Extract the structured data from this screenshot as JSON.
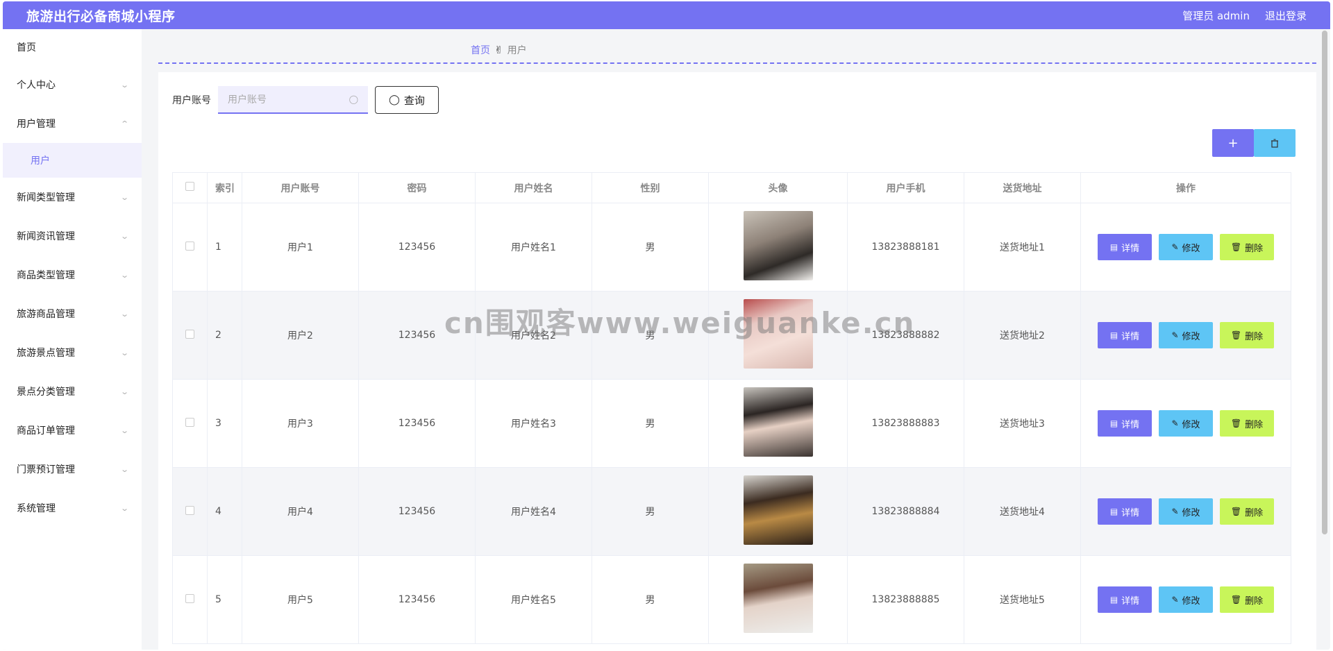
{
  "header": {
    "title": "旅游出行必备商城小程序",
    "user": "管理员 admin",
    "logout": "退出登录"
  },
  "sidebar": {
    "items": [
      {
        "label": "首页",
        "has_children": false
      },
      {
        "label": "个人中心",
        "has_children": true
      },
      {
        "label": "用户管理",
        "has_children": true,
        "expanded": true,
        "children": [
          "用户"
        ]
      },
      {
        "label": "新闻类型管理",
        "has_children": true
      },
      {
        "label": "新闻资讯管理",
        "has_children": true
      },
      {
        "label": "商品类型管理",
        "has_children": true
      },
      {
        "label": "旅游商品管理",
        "has_children": true
      },
      {
        "label": "旅游景点管理",
        "has_children": true
      },
      {
        "label": "景点分类管理",
        "has_children": true
      },
      {
        "label": "商品订单管理",
        "has_children": true
      },
      {
        "label": "门票预订管理",
        "has_children": true
      },
      {
        "label": "系统管理",
        "has_children": true
      }
    ]
  },
  "breadcrumb": {
    "home": "首页",
    "current": "用户"
  },
  "search": {
    "label": "用户账号",
    "placeholder": "用户账号",
    "button": "查询"
  },
  "actions": {
    "add": "+",
    "delete": "🗑"
  },
  "table": {
    "headers": [
      "索引",
      "用户账号",
      "密码",
      "用户姓名",
      "性别",
      "头像",
      "用户手机",
      "送货地址",
      "操作"
    ],
    "rows": [
      {
        "index": "1",
        "account": "用户1",
        "password": "123456",
        "name": "用户姓名1",
        "gender": "男",
        "phone": "13823888181",
        "address": "送货地址1"
      },
      {
        "index": "2",
        "account": "用户2",
        "password": "123456",
        "name": "用户姓名2",
        "gender": "男",
        "phone": "13823888882",
        "address": "送货地址2"
      },
      {
        "index": "3",
        "account": "用户3",
        "password": "123456",
        "name": "用户姓名3",
        "gender": "男",
        "phone": "13823888883",
        "address": "送货地址3"
      },
      {
        "index": "4",
        "account": "用户4",
        "password": "123456",
        "name": "用户姓名4",
        "gender": "男",
        "phone": "13823888884",
        "address": "送货地址4"
      },
      {
        "index": "5",
        "account": "用户5",
        "password": "123456",
        "name": "用户姓名5",
        "gender": "男",
        "phone": "13823888885",
        "address": "送货地址5"
      }
    ],
    "op_labels": {
      "detail": "详情",
      "edit": "修改",
      "remove": "删除"
    }
  },
  "watermark": "cn围观客www.weiguanke.cn",
  "colors": {
    "primary": "#7472f2",
    "info": "#5ec5f5",
    "lime": "#c8f55a"
  }
}
